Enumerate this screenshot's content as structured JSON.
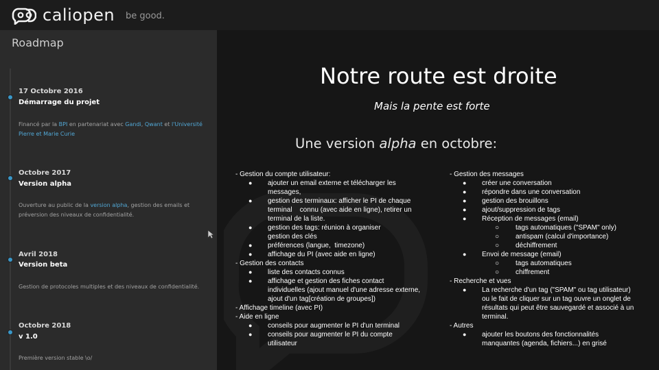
{
  "header": {
    "logo_text": "caliopen",
    "tagline": "be good."
  },
  "sidebar": {
    "title": "Roadmap",
    "events": [
      {
        "date": "17 Octobre 2016",
        "title": "Démarrage du projet",
        "desc_parts": [
          "Financé par la ",
          "BPI",
          " en partenariat avec ",
          "Gandi",
          ", ",
          "Qwant",
          " et ",
          "l'Université Pierre et Marie Curie"
        ]
      },
      {
        "date": "Octobre 2017",
        "title": "Version alpha",
        "desc_parts": [
          "Ouverture au public de la ",
          "version alpha",
          ", gestion des emails et préversion des niveaux de confidentialité."
        ]
      },
      {
        "date": "Avril 2018",
        "title": "Version beta",
        "desc": "Gestion de protocoles multiples et des niveaux de confidentialité."
      },
      {
        "date": "Octobre 2018",
        "title": "v 1.0",
        "desc": "Première version stable \\o/"
      }
    ]
  },
  "slide": {
    "title": "Notre route est droite",
    "subtitle": "Mais la pente est forte",
    "heading_pre": "Une version ",
    "heading_em": "alpha",
    "heading_post": " en octobre:",
    "left": [
      {
        "type": "sec",
        "text": "- Gestion du compte utilisateur:"
      },
      {
        "type": "item",
        "lines": [
          "ajouter un email externe et télécharger les",
          "messages,"
        ]
      },
      {
        "type": "item",
        "lines": [
          "gestion des terminaux: afficher le PI de chaque",
          "terminal    connu (avec aide en ligne), retirer un",
          "terminal de la liste."
        ]
      },
      {
        "type": "item",
        "lines": [
          "gestion des tags: réunion à organiser",
          "gestion des clés"
        ]
      },
      {
        "type": "item",
        "lines": [
          "préférences (langue,  timezone)"
        ]
      },
      {
        "type": "item",
        "lines": [
          "affichage du PI (avec aide en ligne)"
        ]
      },
      {
        "type": "sec",
        "text": "- Gestion des contacts"
      },
      {
        "type": "item",
        "lines": [
          "liste des contacts connus"
        ]
      },
      {
        "type": "item",
        "lines": [
          "affichage et gestion des fiches contact",
          "individuelles (ajout manuel d'une adresse externe,",
          "ajout d'un tag[création de groupes])"
        ]
      },
      {
        "type": "sec",
        "text": "- Affichage timeline (avec PI)"
      },
      {
        "type": "sec",
        "text": "- Aide en ligne"
      },
      {
        "type": "item",
        "lines": [
          "conseils pour augmenter le PI d'un terminal"
        ]
      },
      {
        "type": "item",
        "lines": [
          "conseils pour augmenter le PI du compte",
          "utilisateur"
        ]
      }
    ],
    "right": [
      {
        "type": "sec",
        "text": "- Gestion des messages"
      },
      {
        "type": "item",
        "lines": [
          "créer une conversation"
        ]
      },
      {
        "type": "item",
        "lines": [
          "répondre dans une conversation"
        ]
      },
      {
        "type": "item",
        "lines": [
          "gestion des brouillons"
        ]
      },
      {
        "type": "item",
        "lines": [
          "ajout/suppression de tags"
        ]
      },
      {
        "type": "item",
        "lines": [
          "Réception de messages (email)"
        ]
      },
      {
        "type": "sub",
        "text": "tags automatiques (\"SPAM\" only)"
      },
      {
        "type": "sub",
        "text": "antispam (calcul d'importance)"
      },
      {
        "type": "sub",
        "text": "déchiffrement"
      },
      {
        "type": "item",
        "lines": [
          "Envoi de message (email)"
        ]
      },
      {
        "type": "sub",
        "text": "tags automatiques"
      },
      {
        "type": "sub",
        "text": "chiffrement"
      },
      {
        "type": "sec",
        "text": "- Recherche et vues"
      },
      {
        "type": "item",
        "lines": [
          "La recherche d'un tag (\"SPAM\" ou tag utilisateur)",
          "ou le fait de cliquer sur un tag ouvre un onglet de",
          "résultats qui peut être sauvegardé et associé à un",
          "terminal."
        ]
      },
      {
        "type": "sec",
        "text": "- Autres"
      },
      {
        "type": "item",
        "lines": [
          "ajouter les boutons des fonctionnalités",
          "manquantes (agenda, fichiers...) en grisé"
        ]
      }
    ],
    "bullet": "●",
    "sub_bullet": "○"
  },
  "colors": {
    "topbar": "#1c1c1c",
    "sidebar": "#2b2b2b",
    "main": "#161616",
    "accent": "#3a97c8",
    "link": "#52a8d6"
  }
}
